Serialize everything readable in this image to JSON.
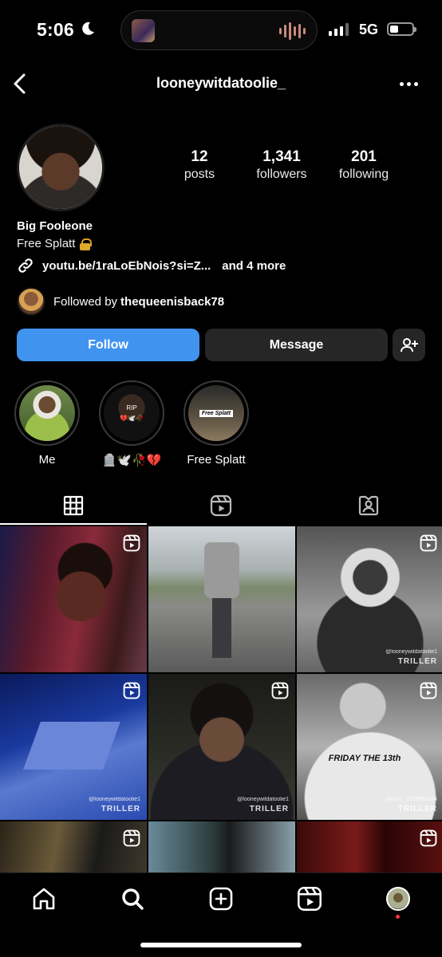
{
  "status_bar": {
    "time": "5:06",
    "network": "5G"
  },
  "header": {
    "username": "looneywitdatoolie_"
  },
  "profile": {
    "stats": [
      {
        "num": "12",
        "label": "posts"
      },
      {
        "num": "1,341",
        "label": "followers"
      },
      {
        "num": "201",
        "label": "following"
      }
    ],
    "display_name": "Big Fooleone",
    "bio": "Free Splatt",
    "link": "youtu.be/1raLoEbNois?si=Z...",
    "more_links": "and 4 more",
    "followed_by_prefix": "Followed by",
    "followed_by_user": "thequeenisback78"
  },
  "buttons": {
    "follow": "Follow",
    "message": "Message"
  },
  "highlights": [
    {
      "label": "Me"
    },
    {
      "label": "🪦🕊️🥀💔"
    },
    {
      "label": "Free Splatt",
      "inner_text": "Free Splatt"
    }
  ],
  "highlight2_text": {
    "top": "RIP",
    "bottom": "💔🕊️🥀"
  },
  "grid": [
    {
      "type": "reel"
    },
    {
      "type": "image"
    },
    {
      "type": "reel",
      "watermark_user": "@looneywitdatoolie1",
      "watermark_app": "TRILLER"
    },
    {
      "type": "reel",
      "watermark_user": "@looneywitdatoolie1",
      "watermark_app": "TRILLER"
    },
    {
      "type": "reel",
      "watermark_user": "@looneywitdatoolie1",
      "watermark_app": "TRILLER"
    },
    {
      "type": "reel",
      "watermark_user": "@user_1529965244",
      "watermark_app": "TRILLER",
      "shirt_text": "FRIDAY THE 13th"
    },
    {
      "type": "reel"
    },
    {
      "type": "image"
    },
    {
      "type": "reel"
    }
  ],
  "colors": {
    "follow_button": "#4193f0",
    "secondary_button": "#262626",
    "background": "#000000",
    "notification_dot": "#ff3040"
  }
}
